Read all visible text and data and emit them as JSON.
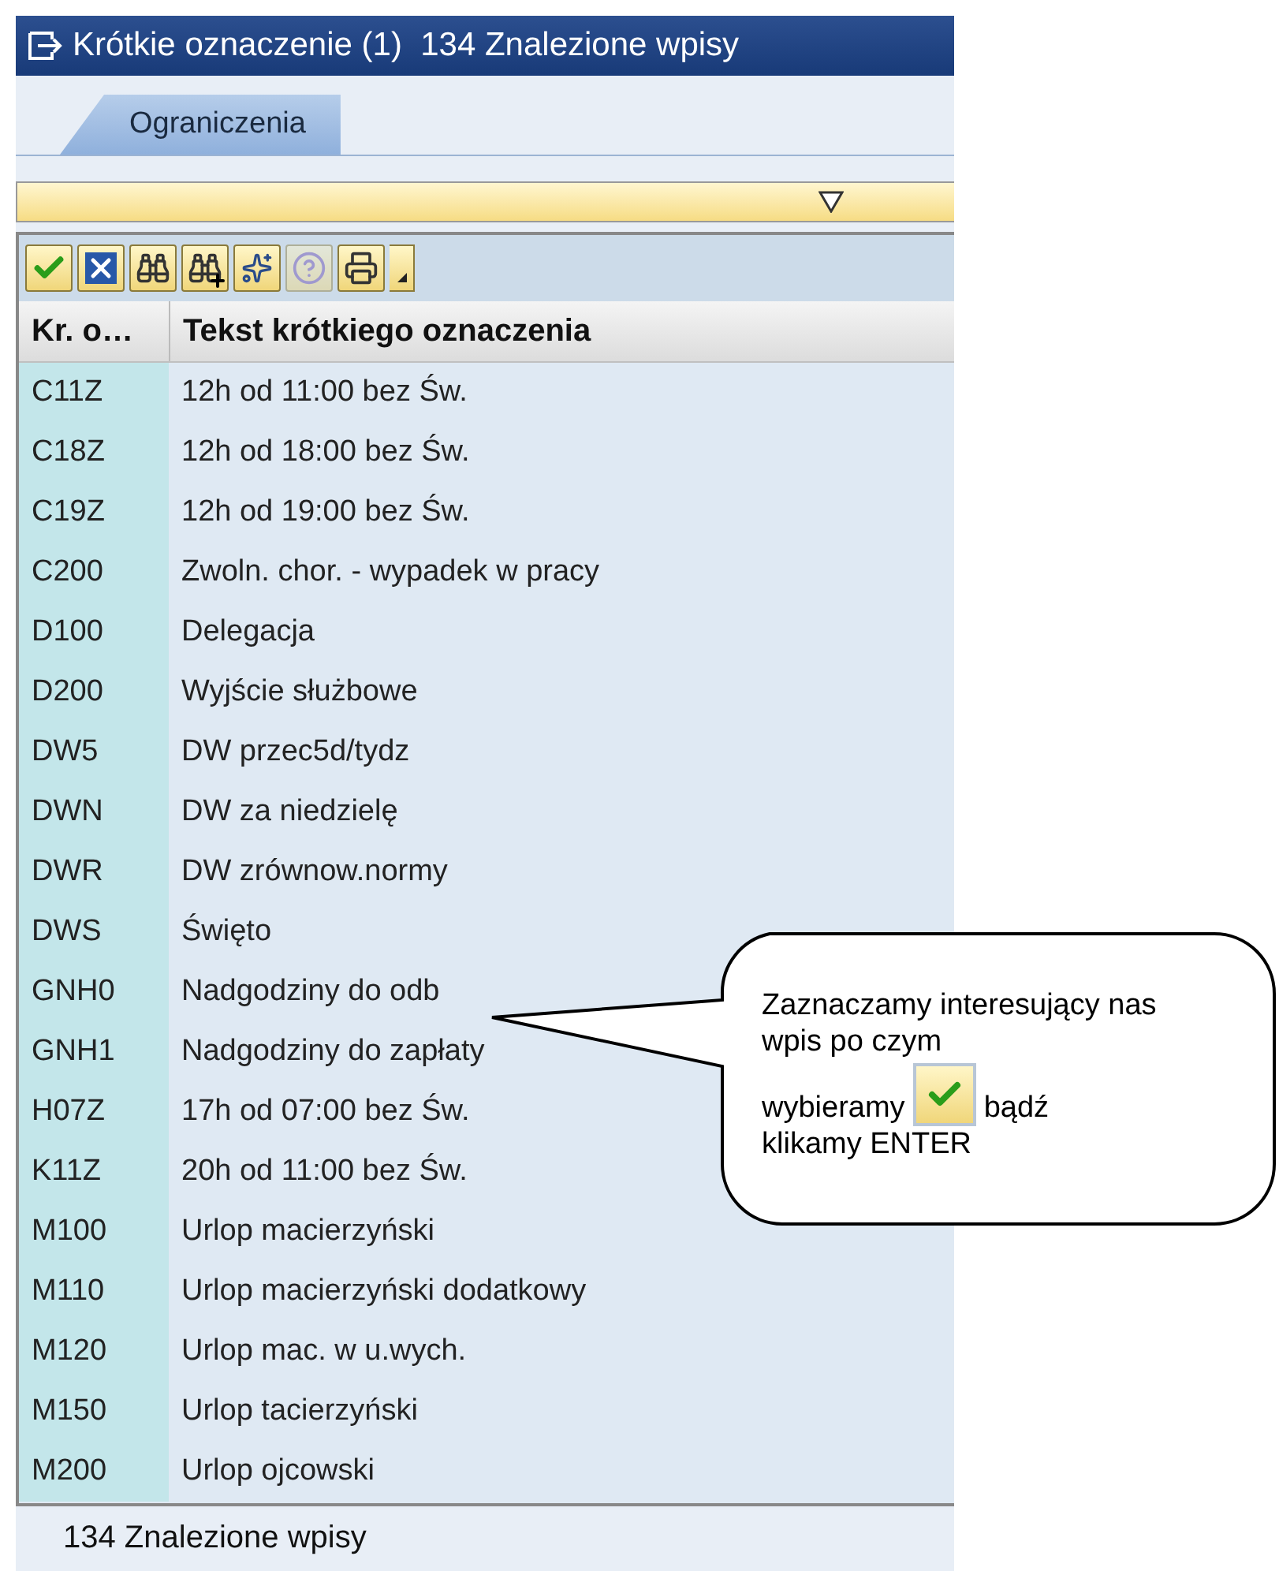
{
  "window": {
    "title": "Krótkie oznaczenie (1)  134 Znalezione wpisy"
  },
  "tabs": [
    {
      "label": "Ograniczenia",
      "selected": true
    }
  ],
  "toolbar": [
    {
      "kind": "confirm",
      "disabled": false
    },
    {
      "kind": "cancel",
      "disabled": false
    },
    {
      "kind": "find",
      "disabled": false
    },
    {
      "kind": "find-next",
      "disabled": false
    },
    {
      "kind": "new",
      "disabled": false
    },
    {
      "kind": "help",
      "disabled": true
    },
    {
      "kind": "print",
      "disabled": false
    }
  ],
  "table": {
    "columns": [
      "Kr. o…",
      "Tekst krótkiego oznaczenia"
    ],
    "rows": [
      [
        "C11Z",
        "12h od 11:00 bez Św."
      ],
      [
        "C18Z",
        "12h od 18:00 bez Św."
      ],
      [
        "C19Z",
        "12h od 19:00 bez Św."
      ],
      [
        "C200",
        "Zwoln. chor. - wypadek w pracy"
      ],
      [
        "D100",
        "Delegacja"
      ],
      [
        "D200",
        "Wyjście służbowe"
      ],
      [
        "DW5",
        "DW przec5d/tydz"
      ],
      [
        "DWN",
        "DW za niedzielę"
      ],
      [
        "DWR",
        "DW zrównow.normy"
      ],
      [
        "DWS",
        "Święto"
      ],
      [
        "GNH0",
        "Nadgodziny do odb"
      ],
      [
        "GNH1",
        "Nadgodziny do zapłaty"
      ],
      [
        "H07Z",
        "17h od 07:00 bez Św."
      ],
      [
        "K11Z",
        "20h od 11:00 bez Św."
      ],
      [
        "M100",
        "Urlop macierzyński"
      ],
      [
        "M110",
        "Urlop macierzyński dodatkowy"
      ],
      [
        "M120",
        "Urlop mac. w u.wych."
      ],
      [
        "M150",
        "Urlop tacierzyński"
      ],
      [
        "M200",
        "Urlop ojcowski"
      ]
    ]
  },
  "status_bar": "134 Znalezione wpisy",
  "callout": {
    "lines": [
      "Zaznaczamy interesujący nas wpis po czym",
      "wybieramy",
      "bądź",
      "klikamy ENTER"
    ]
  }
}
